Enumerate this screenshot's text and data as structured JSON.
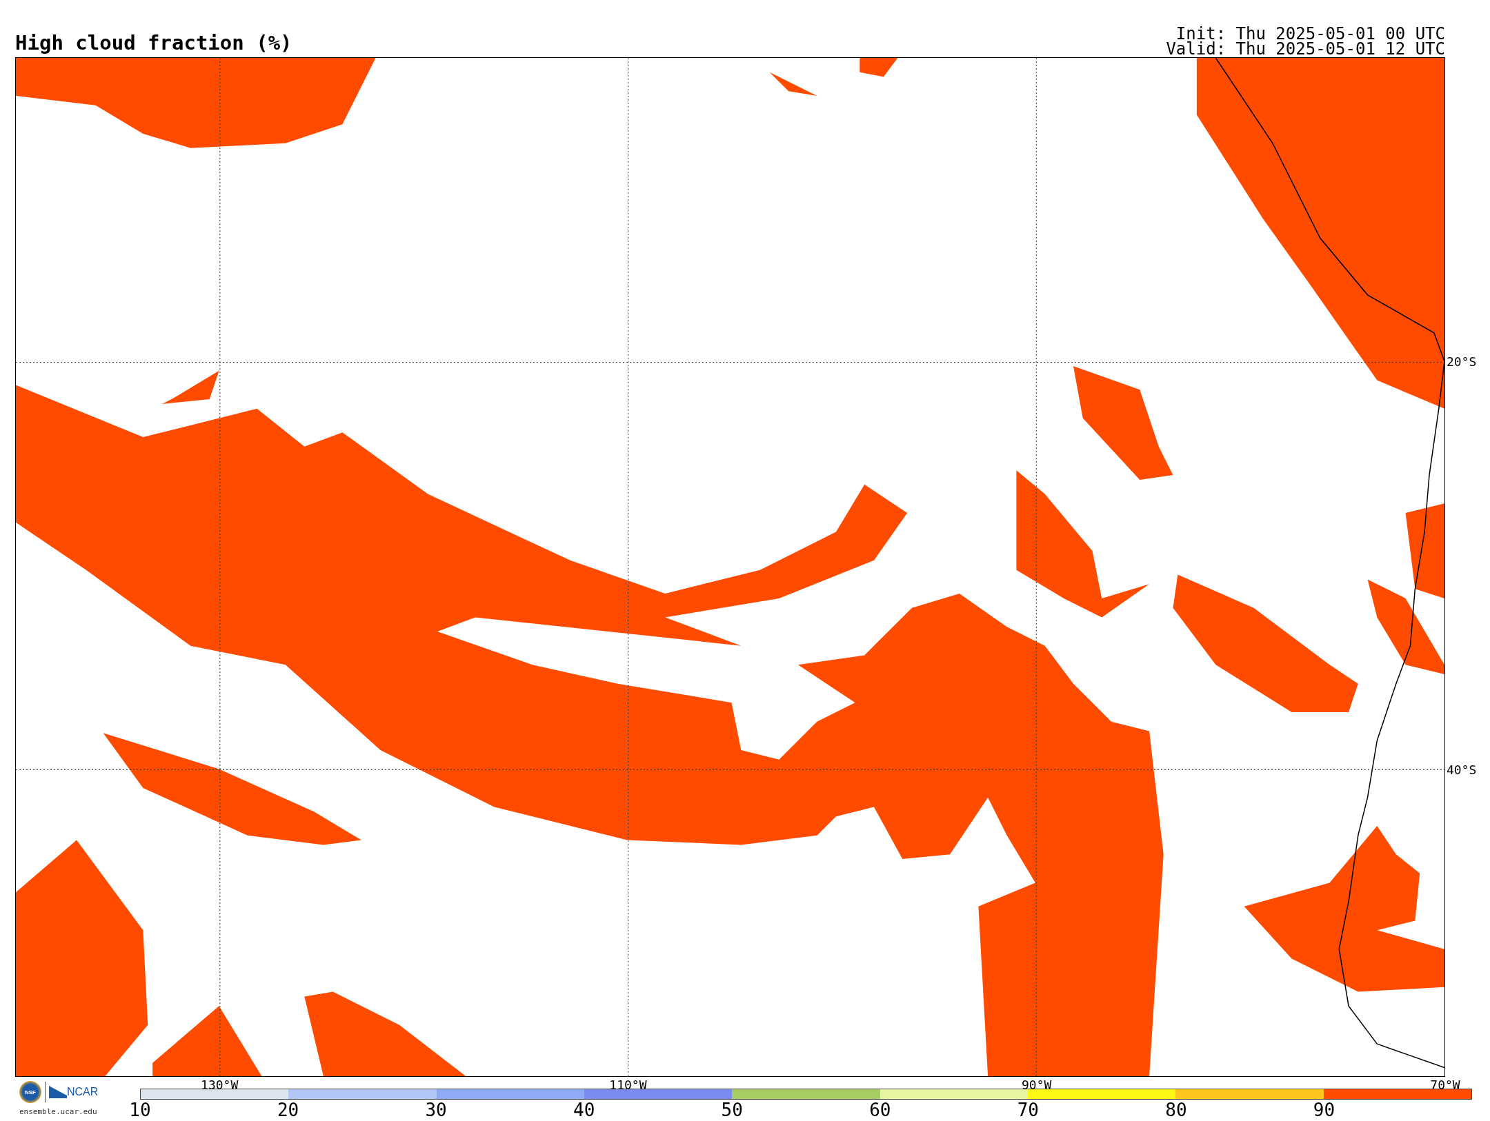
{
  "title": "High cloud fraction (%)",
  "init": "Init: Thu 2025-05-01 00 UTC",
  "valid": "Valid: Thu 2025-05-01 12 UTC",
  "map": {
    "meridians": [
      "130°W",
      "110°W",
      "90°W",
      "70°W"
    ],
    "parallels": [
      "20°S",
      "40°S"
    ]
  },
  "logos": {
    "nsf": "NSF",
    "ncar": "NCAR",
    "url": "ensemble.ucar.edu"
  },
  "colorbar": {
    "segments": [
      {
        "label": "10",
        "color": "#dce5ee"
      },
      {
        "label": "20",
        "color": "#b3c7f6"
      },
      {
        "label": "30",
        "color": "#8fabf5"
      },
      {
        "label": "40",
        "color": "#7a8cf0"
      },
      {
        "label": "50",
        "color": "#a6cc62"
      },
      {
        "label": "60",
        "color": "#e6f5a0"
      },
      {
        "label": "70",
        "color": "#fff814"
      },
      {
        "label": "80",
        "color": "#ffc71e"
      },
      {
        "label": "90",
        "color": "#ff4b00"
      }
    ]
  }
}
